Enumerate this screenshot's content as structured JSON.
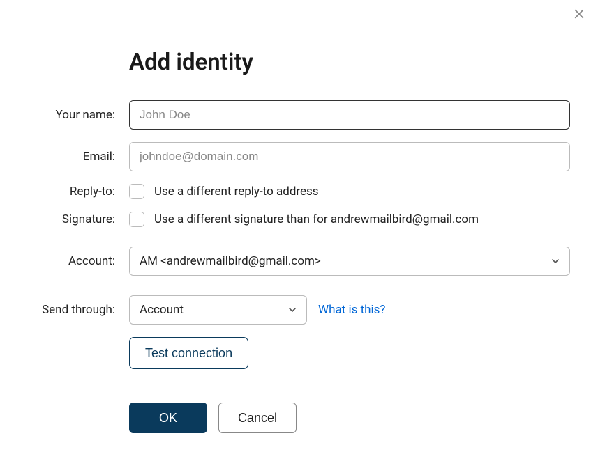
{
  "dialog": {
    "title": "Add identity",
    "close_icon": "close"
  },
  "fields": {
    "name": {
      "label": "Your name:",
      "value": "",
      "placeholder": "John Doe"
    },
    "email": {
      "label": "Email:",
      "value": "",
      "placeholder": "johndoe@domain.com"
    },
    "reply_to": {
      "label": "Reply-to:",
      "checkbox_label": "Use a different reply-to address",
      "checked": false
    },
    "signature": {
      "label": "Signature:",
      "checkbox_label": "Use a different signature than for andrewmailbird@gmail.com",
      "checked": false
    },
    "account": {
      "label": "Account:",
      "selected": "AM <andrewmailbird@gmail.com>"
    },
    "send_through": {
      "label": "Send through:",
      "selected": "Account",
      "help_link": "What is this?"
    }
  },
  "buttons": {
    "test_connection": "Test connection",
    "ok": "OK",
    "cancel": "Cancel"
  }
}
